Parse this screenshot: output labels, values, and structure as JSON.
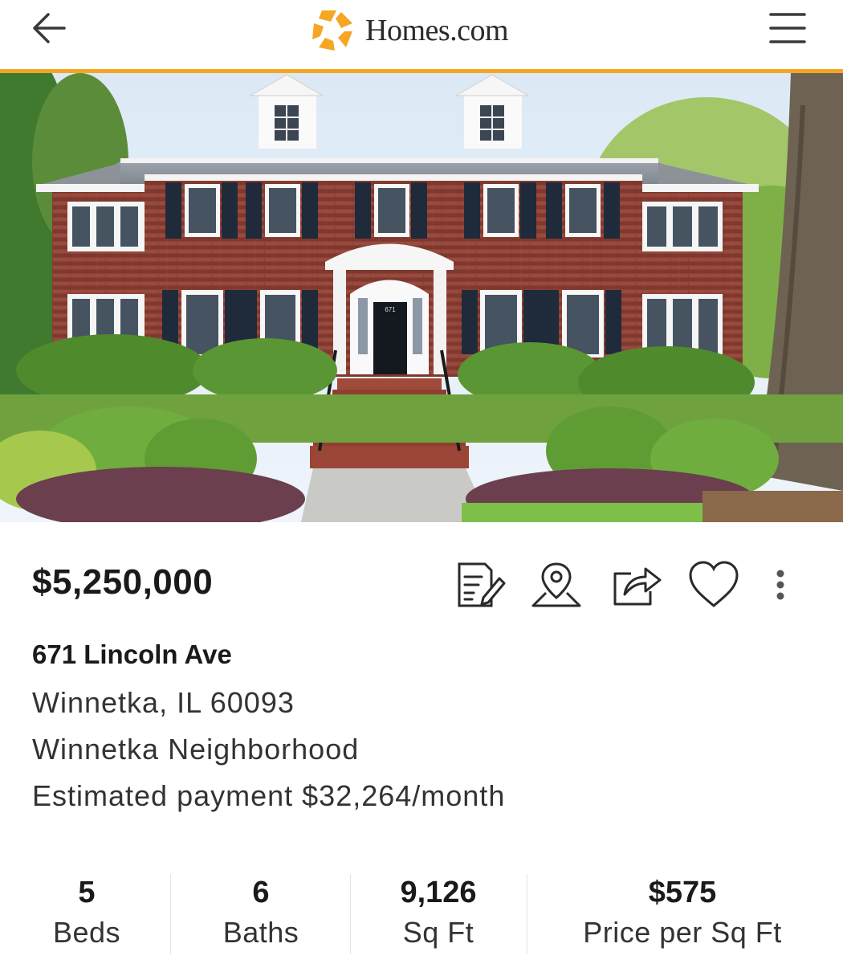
{
  "header": {
    "brand": "Homes.com",
    "brand_color": "#f5a623",
    "back_icon": "arrow-left-icon",
    "menu_icon": "hamburger-icon"
  },
  "hero": {
    "image": "brick-colonial-house-photo"
  },
  "listing": {
    "price": "$5,250,000",
    "street": "671 Lincoln Ave",
    "city_line": "Winnetka, IL 60093",
    "neighborhood": "Winnetka Neighborhood",
    "estimated_payment": "Estimated payment $32,264/month"
  },
  "actions": [
    {
      "icon": "notes-icon"
    },
    {
      "icon": "map-pin-icon"
    },
    {
      "icon": "share-icon"
    },
    {
      "icon": "heart-icon"
    },
    {
      "icon": "more-vertical-icon"
    }
  ],
  "stats": [
    {
      "value": "5",
      "label": "Beds"
    },
    {
      "value": "6",
      "label": "Baths"
    },
    {
      "value": "9,126",
      "label": "Sq Ft"
    },
    {
      "value": "$575",
      "label": "Price per Sq Ft"
    }
  ]
}
